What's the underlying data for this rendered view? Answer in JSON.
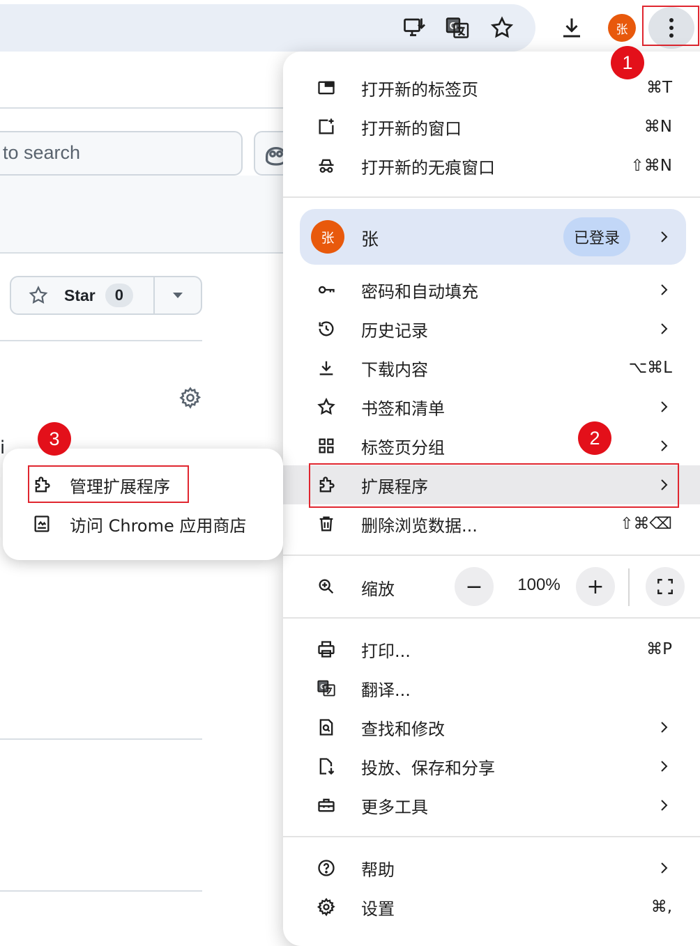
{
  "toolbar": {
    "avatar_initial": "张",
    "buttons": [
      "install-app-icon",
      "translate-icon",
      "bookmark-star-icon",
      "download-icon",
      "more-menu-icon"
    ]
  },
  "background_page": {
    "search_placeholder": "to search",
    "star_label": "Star",
    "star_count": "0",
    "fragment_text": "i"
  },
  "callouts": {
    "one": "1",
    "two": "2",
    "three": "3"
  },
  "menu": {
    "group1": [
      {
        "label": "打开新的标签页",
        "shortcut": "⌘T",
        "icon": "new-tab-icon"
      },
      {
        "label": "打开新的窗口",
        "shortcut": "⌘N",
        "icon": "new-window-icon"
      },
      {
        "label": "打开新的无痕窗口",
        "shortcut": "⇧⌘N",
        "icon": "incognito-icon"
      }
    ],
    "profile": {
      "avatar": "张",
      "name": "张",
      "status": "已登录"
    },
    "group2": [
      {
        "label": "密码和自动填充",
        "icon": "key-icon"
      },
      {
        "label": "历史记录",
        "icon": "history-icon"
      },
      {
        "label": "下载内容",
        "shortcut": "⌥⌘L",
        "icon": "download-icon"
      },
      {
        "label": "书签和清单",
        "icon": "star-icon"
      },
      {
        "label": "标签页分组",
        "icon": "tab-groups-icon"
      },
      {
        "label": "扩展程序",
        "icon": "extension-icon"
      },
      {
        "label": "删除浏览数据...",
        "shortcut": "⇧⌘⌫",
        "icon": "trash-icon"
      }
    ],
    "zoom": {
      "label": "缩放",
      "minus": "−",
      "value": "100%",
      "plus": "+"
    },
    "group3": [
      {
        "label": "打印...",
        "shortcut": "⌘P",
        "icon": "print-icon"
      },
      {
        "label": "翻译...",
        "icon": "translate-icon"
      },
      {
        "label": "查找和修改",
        "icon": "find-icon"
      },
      {
        "label": "投放、保存和分享",
        "icon": "cast-save-share-icon"
      },
      {
        "label": "更多工具",
        "icon": "toolbox-icon"
      }
    ],
    "group4": [
      {
        "label": "帮助",
        "icon": "help-icon"
      },
      {
        "label": "设置",
        "shortcut": "⌘,",
        "icon": "settings-icon"
      }
    ]
  },
  "submenu": {
    "items": [
      {
        "label": "管理扩展程序",
        "icon": "extension-icon"
      },
      {
        "label": "访问 Chrome 应用商店",
        "icon": "web-store-icon"
      }
    ]
  },
  "colors": {
    "accent_red": "#e3101a",
    "avatar_orange": "#e8590c",
    "profile_bg": "#dfe7f6",
    "signed_in_chip": "#c2d7f7"
  }
}
